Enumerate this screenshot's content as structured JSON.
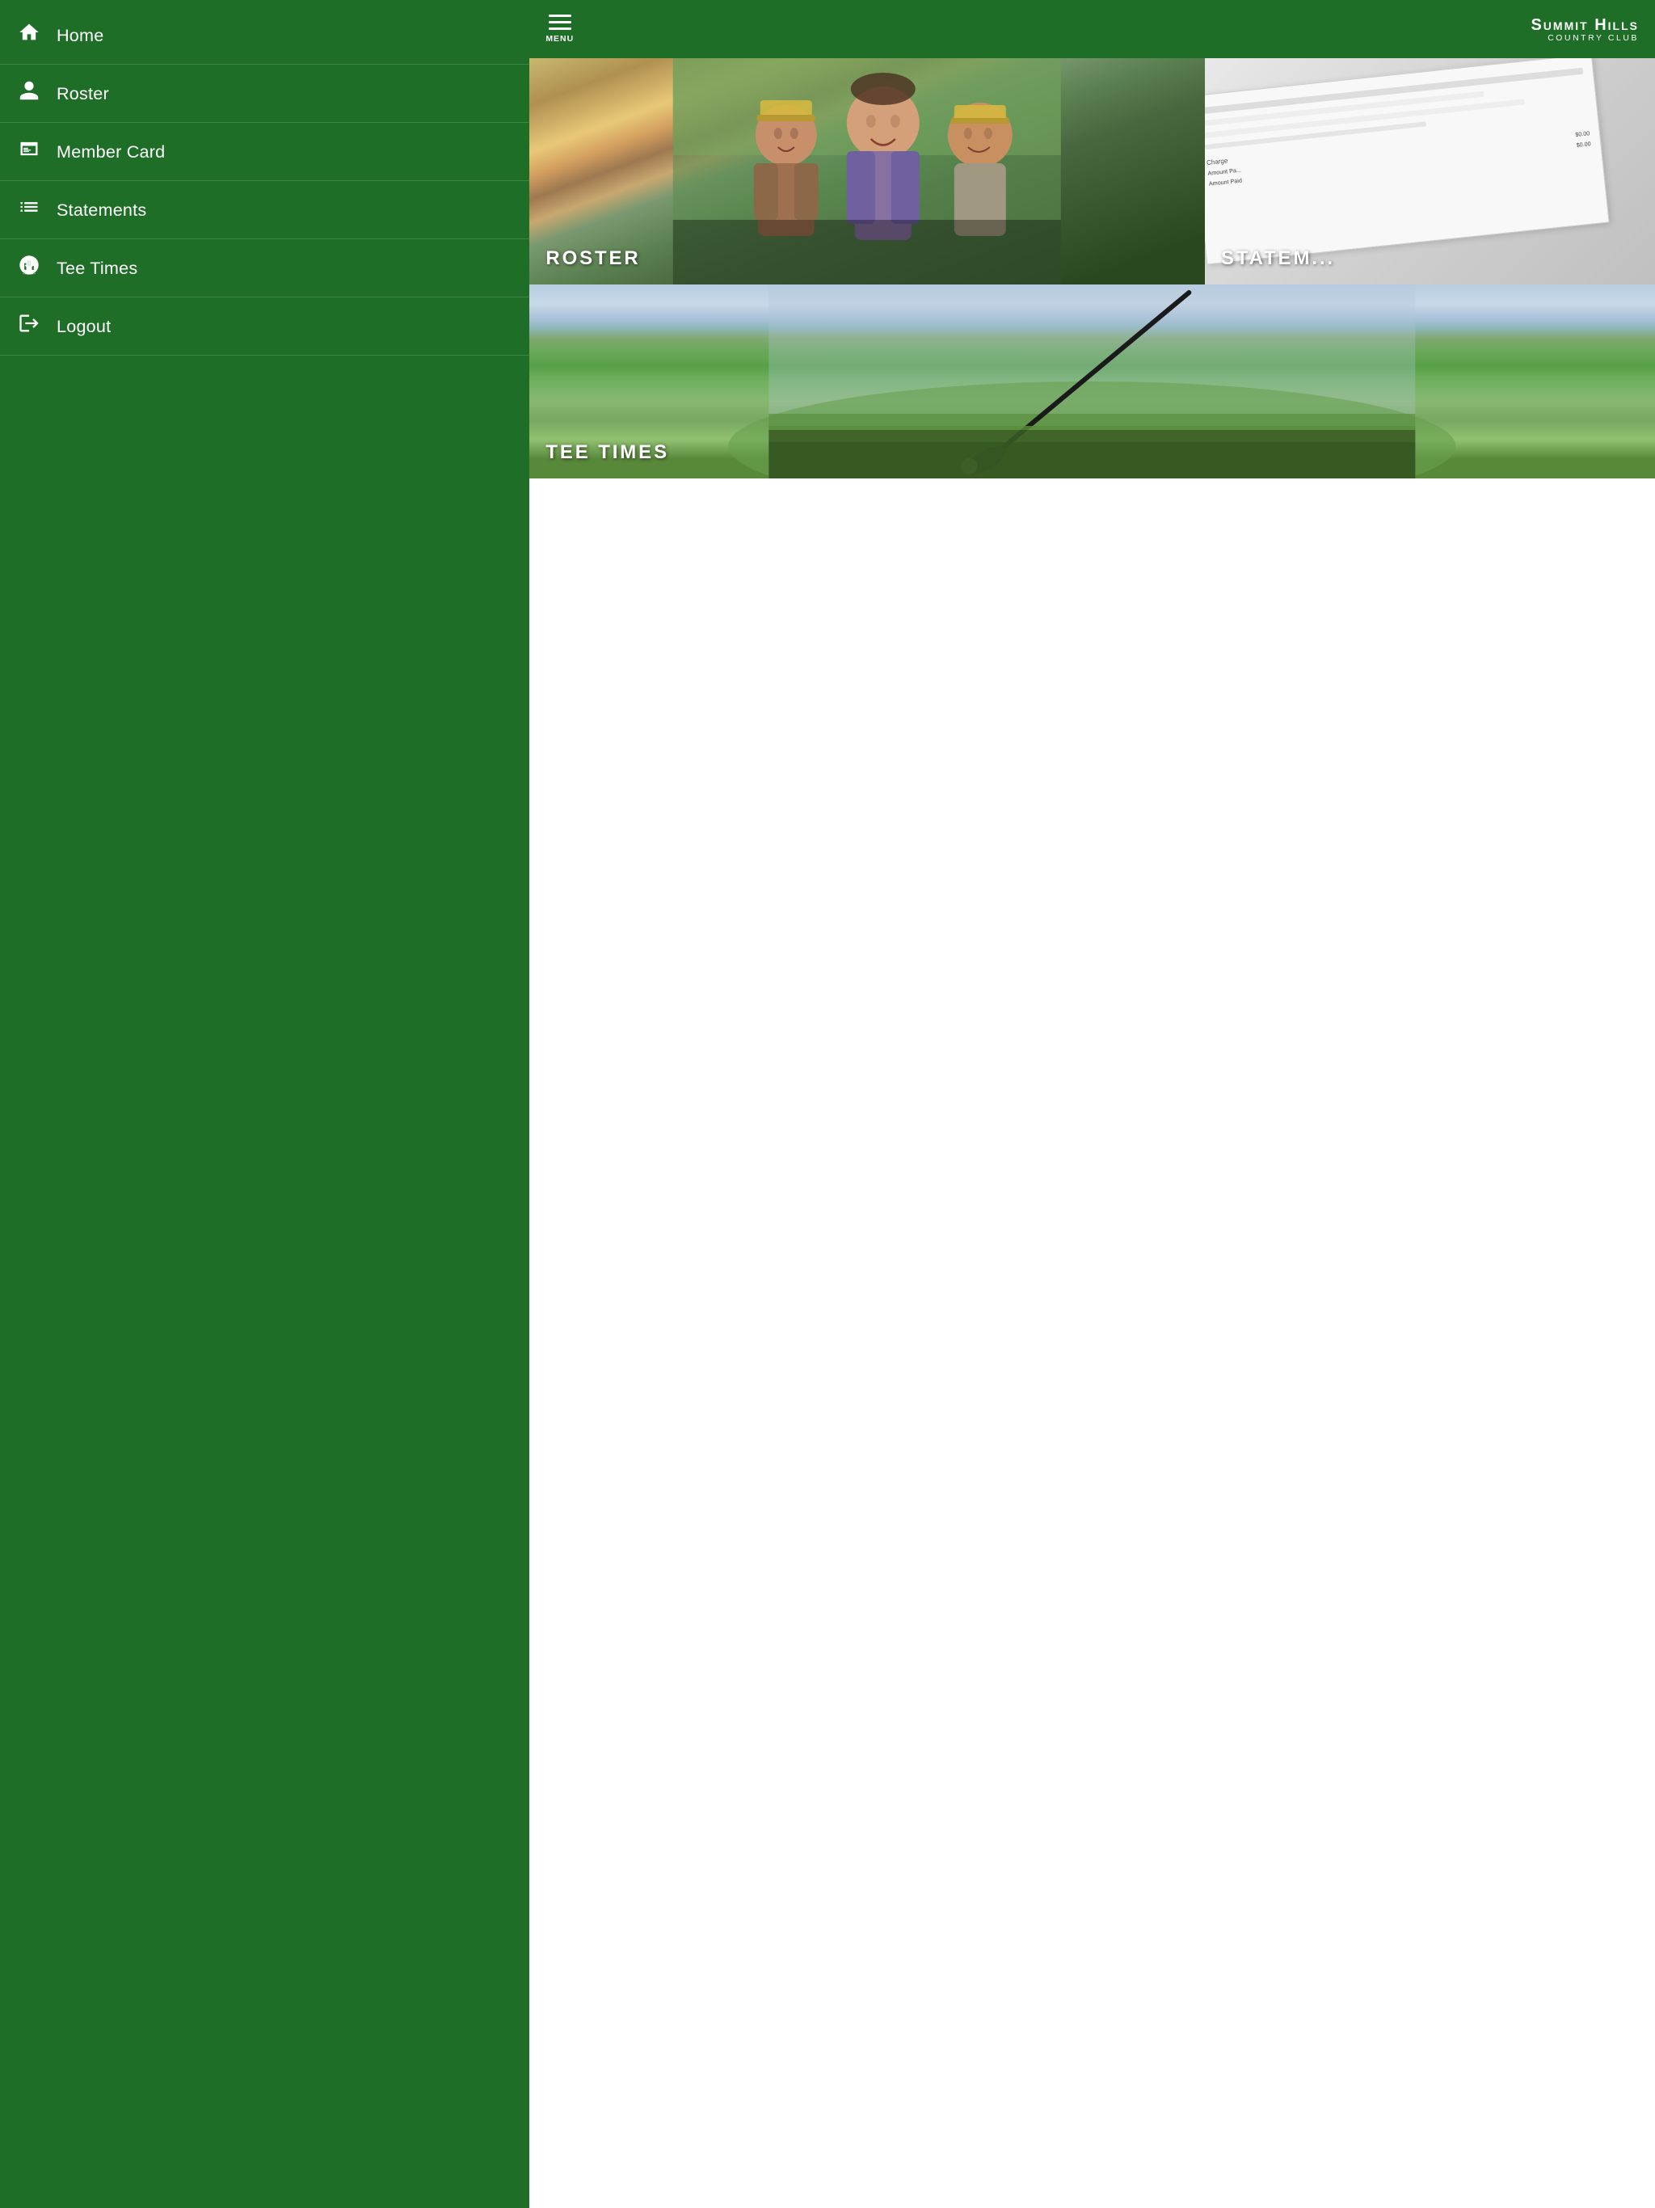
{
  "brand": {
    "name": "Summit Hills",
    "sub": "Country Club"
  },
  "menu": {
    "label": "MENU"
  },
  "sidebar": {
    "items": [
      {
        "id": "home",
        "label": "Home",
        "icon": "home"
      },
      {
        "id": "roster",
        "label": "Roster",
        "icon": "person"
      },
      {
        "id": "member-card",
        "label": "Member Card",
        "icon": "card"
      },
      {
        "id": "statements",
        "label": "Statements",
        "icon": "list"
      },
      {
        "id": "tee-times",
        "label": "Tee Times",
        "icon": "golf"
      },
      {
        "id": "logout",
        "label": "Logout",
        "icon": "logout"
      }
    ]
  },
  "cards": {
    "roster": {
      "label": "ROSTER"
    },
    "statements": {
      "label": "STATEM..."
    },
    "tee_times": {
      "label": "TEE TIMES"
    }
  }
}
